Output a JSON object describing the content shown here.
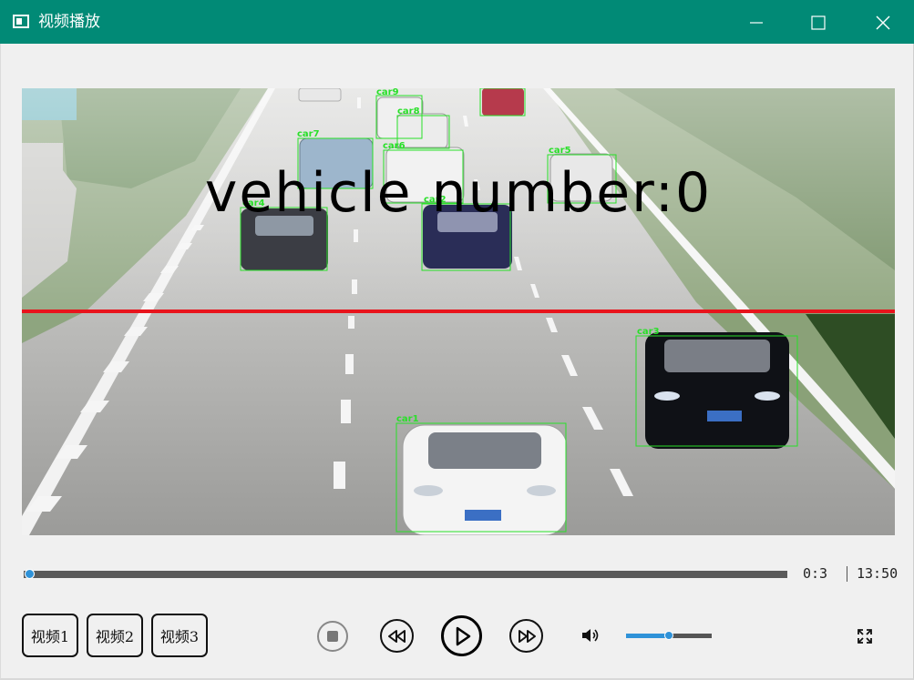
{
  "window": {
    "title": "视频播放"
  },
  "video": {
    "overlay_text": "vehicle number:0",
    "detections": [
      "car1",
      "car2",
      "car3",
      "car4",
      "car5",
      "car6",
      "car7",
      "car8",
      "car9"
    ]
  },
  "playback": {
    "current_time": "0:3",
    "total_time": "13:50",
    "progress": 0.005,
    "volume": 0.5
  },
  "buttons": {
    "video1": "视频1",
    "video2": "视频2",
    "video3": "视频3"
  },
  "colors": {
    "titlebar": "#018a76",
    "accent": "#2f92d8",
    "count_line": "#e8141c",
    "detection_box": "#28e028"
  }
}
